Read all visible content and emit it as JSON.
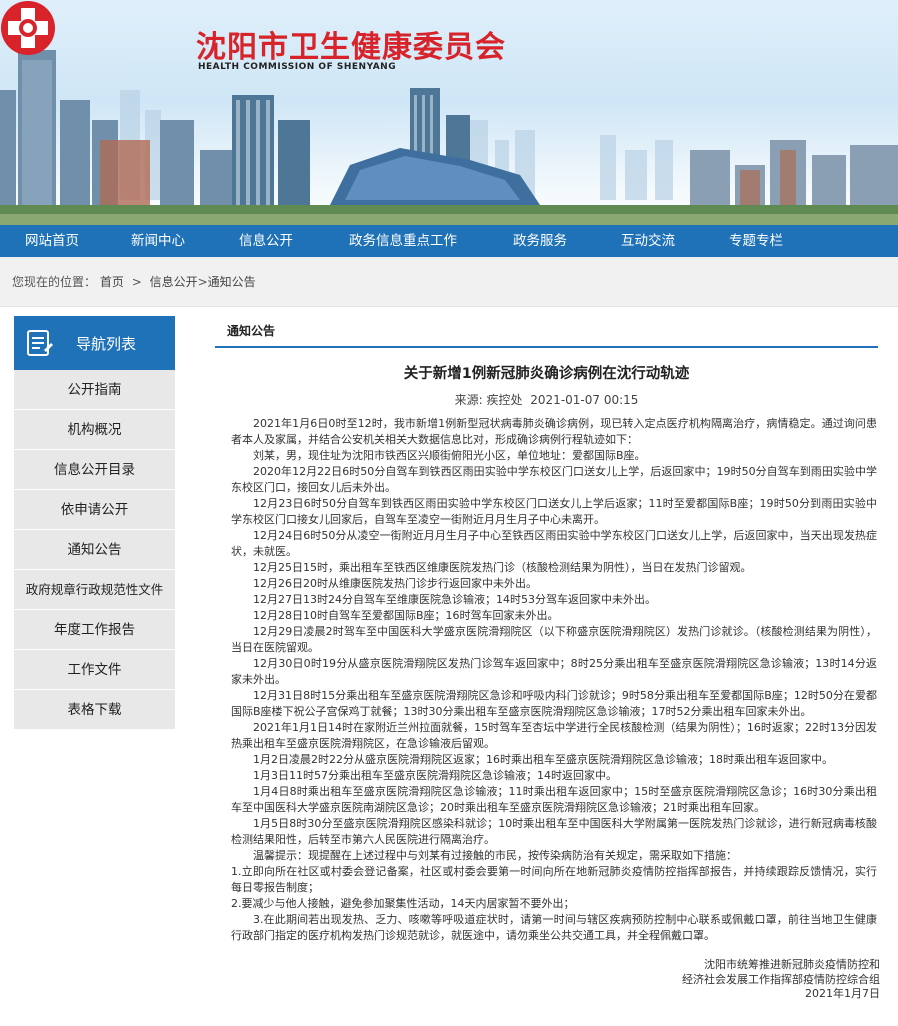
{
  "header": {
    "site_title": "沈阳市卫生健康委员会",
    "site_subtitle": "HEALTH COMMISSION OF SHENYANG"
  },
  "nav": {
    "items": [
      "网站首页",
      "新闻中心",
      "信息公开",
      "政务信息重点工作",
      "政务服务",
      "互动交流",
      "专题专栏"
    ]
  },
  "breadcrumb": {
    "prefix": "您现在的位置：",
    "items": [
      "首页",
      "信息公开",
      "通知公告"
    ],
    "separator": ">"
  },
  "sidebar": {
    "title": "导航列表",
    "items": [
      "公开指南",
      "机构概况",
      "信息公开目录",
      "依申请公开",
      "通知公告",
      "政府规章行政规范性文件",
      "年度工作报告",
      "工作文件",
      "表格下载"
    ]
  },
  "main": {
    "tab_label": "通知公告",
    "article_title": "关于新增1例新冠肺炎确诊病例在沈行动轨迹",
    "source_label": "来源:",
    "source": "疾控处",
    "date": "2021-01-07 00:15",
    "paragraphs": [
      "2021年1月6日0时至12时，我市新增1例新型冠状病毒肺炎确诊病例，现已转入定点医疗机构隔离治疗，病情稳定。通过询问患者本人及家属，并结合公安机关相关大数据信息比对，形成确诊病例行程轨迹如下：",
      "刘某，男，现住址为沈阳市铁西区兴顺街俯阳光小区，单位地址：爱都国际B座。",
      "2020年12月22日6时50分自驾车到铁西区雨田实验中学东校区门口送女儿上学，后返回家中；19时50分自驾车到雨田实验中学东校区门口，接回女儿后未外出。",
      "12月23日6时50分自驾车到铁西区雨田实验中学东校区门口送女儿上学后返家；11时至爱都国际B座；19时50分到雨田实验中学东校区门口接女儿回家后，自驾车至凌空一街附近月月生月子中心未离开。",
      "12月24日6时50分从凌空一街附近月月生月子中心至铁西区雨田实验中学东校区门口送女儿上学，后返回家中，当天出现发热症状，未就医。",
      "12月25日15时，乘出租车至铁西区维康医院发热门诊（核酸检测结果为阴性），当日在发热门诊留观。",
      "12月26日20时从维康医院发热门诊步行返回家中未外出。",
      "12月27日13时24分自驾车至维康医院急诊输液；14时53分驾车返回家中未外出。",
      "12月28日10时自驾车至爱都国际B座；16时驾车回家未外出。",
      "12月29日凌晨2时驾车至中国医科大学盛京医院滑翔院区（以下称盛京医院滑翔院区）发热门诊就诊。（核酸检测结果为阴性），当日在医院留观。",
      "12月30日0时19分从盛京医院滑翔院区发热门诊驾车返回家中；8时25分乘出租车至盛京医院滑翔院区急诊输液；13时14分返家未外出。",
      "12月31日8时15分乘出租车至盛京医院滑翔院区急诊和呼吸内科门诊就诊；9时58分乘出租车至爱都国际B座；12时50分在爱都国际B座楼下祝公子宫保鸡丁就餐；13时30分乘出租车至盛京医院滑翔院区急诊输液；17时52分乘出租车回家未外出。",
      "2021年1月1日14时在家附近兰州拉面就餐，15时驾车至杏坛中学进行全民核酸检测（结果为阴性）；16时返家；22时13分因发热乘出租车至盛京医院滑翔院区，在急诊输液后留观。",
      "1月2日凌晨2时22分从盛京医院滑翔院区返家；16时乘出租车至盛京医院滑翔院区急诊输液；18时乘出租车返回家中。",
      "1月3日11时57分乘出租车至盛京医院滑翔院区急诊输液；14时返回家中。",
      "1月4日8时乘出租车至盛京医院滑翔院区急诊输液；11时乘出租车返回家中；15时至盛京医院滑翔院区急诊；16时30分乘出租车至中国医科大学盛京医院南湖院区急诊；20时乘出租车至盛京医院滑翔院区急诊输液；21时乘出租车回家。",
      "1月5日8时30分至盛京医院滑翔院区感染科就诊；10时乘出租车至中国医科大学附属第一医院发热门诊就诊，进行新冠病毒核酸检测结果阳性，后转至市第六人民医院进行隔离治疗。",
      "温馨提示：现提醒在上述过程中与刘某有过接触的市民，按传染病防治有关规定，需采取如下措施：",
      "1.立即向所在社区或村委会登记备案，社区或村委会要第一时间向所在地新冠肺炎疫情防控指挥部报告，并持续跟踪反馈情况，实行每日零报告制度；",
      "2.要减少与他人接触，避免参加聚集性活动，14天内居家暂不要外出；",
      "3.在此期间若出现发热、乏力、咳嗽等呼吸道症状时，请第一时间与辖区疾病预防控制中心联系或佩戴口罩，前往当地卫生健康行政部门指定的医疗机构发热门诊规范就诊，就医途中，请勿乘坐公共交通工具，并全程佩戴口罩。"
    ],
    "signature": [
      "沈阳市统筹推进新冠肺炎疫情防控和",
      "经济社会发展工作指挥部疫情防控综合组",
      "2021年1月7日"
    ]
  },
  "colors": {
    "brand_red": "#d8232a",
    "nav_blue": "#1f72b8",
    "sidebar_item_bg": "#e8e8e8"
  },
  "icons": {
    "logo": "health-commission-emblem",
    "sidebar_head": "document-list-icon"
  }
}
